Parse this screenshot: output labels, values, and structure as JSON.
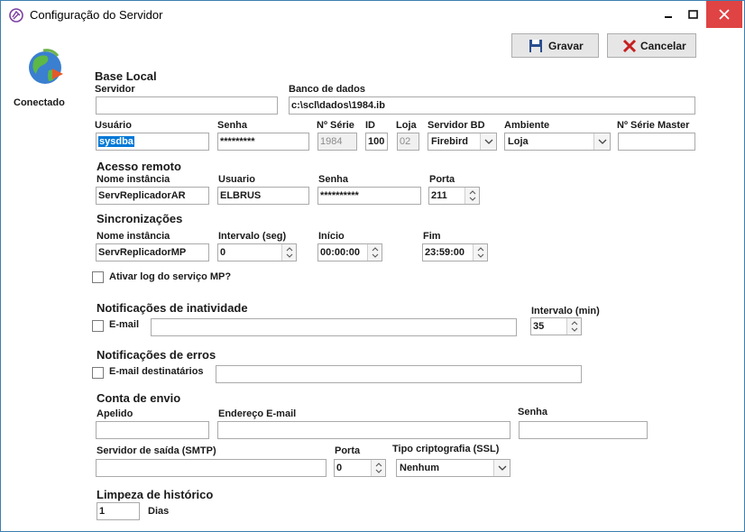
{
  "window": {
    "title": "Configuração do Servidor"
  },
  "toolbar": {
    "save_label": "Gravar",
    "cancel_label": "Cancelar"
  },
  "status": {
    "label": "Conectado"
  },
  "base_local": {
    "section": "Base Local",
    "servidor_label": "Servidor",
    "servidor_value": "",
    "banco_label": "Banco de dados",
    "banco_value": "c:\\scl\\dados\\1984.ib",
    "usuario_label": "Usuário",
    "usuario_value": "sysdba",
    "senha_label": "Senha",
    "senha_value": "*********",
    "serie_label": "Nº Série",
    "serie_value": "1984",
    "id_label": "ID",
    "id_value": "100",
    "loja_label": "Loja",
    "loja_value": "02",
    "servidor_bd_label": "Servidor BD",
    "servidor_bd_value": "Firebird",
    "ambiente_label": "Ambiente",
    "ambiente_value": "Loja",
    "serie_master_label": "Nº Série Master",
    "serie_master_value": ""
  },
  "acesso_remoto": {
    "section": "Acesso remoto",
    "instancia_label": "Nome instância",
    "instancia_value": "ServReplicadorAR",
    "usuario_label": "Usuario",
    "usuario_value": "ELBRUS",
    "senha_label": "Senha",
    "senha_value": "**********",
    "porta_label": "Porta",
    "porta_value": "211"
  },
  "sincronizacoes": {
    "section": "Sincronizações",
    "instancia_label": "Nome instância",
    "instancia_value": "ServReplicadorMP",
    "intervalo_label": "Intervalo (seg)",
    "intervalo_value": "0",
    "inicio_label": "Início",
    "inicio_value": "00:00:00",
    "fim_label": "Fim",
    "fim_value": "23:59:00",
    "log_label": "Ativar log do serviço MP?"
  },
  "inatividade": {
    "section": "Notificações de inatividade",
    "email_label": "E-mail",
    "email_value": "",
    "intervalo_label": "Intervalo (min)",
    "intervalo_value": "35"
  },
  "erros": {
    "section": "Notificações de erros",
    "email_label": "E-mail destinatários",
    "email_value": ""
  },
  "conta_envio": {
    "section": "Conta de envio",
    "apelido_label": "Apelido",
    "apelido_value": "",
    "endereco_label": "Endereço E-mail",
    "endereco_value": "",
    "senha_label": "Senha",
    "senha_value": "",
    "smtp_label": "Servidor de saída (SMTP)",
    "smtp_value": "",
    "porta_label": "Porta",
    "porta_value": "0",
    "cripto_label": "Tipo criptografia (SSL)",
    "cripto_value": "Nenhum"
  },
  "limpeza": {
    "section": "Limpeza de histórico",
    "dias_value": "1",
    "dias_label": "Dias"
  }
}
